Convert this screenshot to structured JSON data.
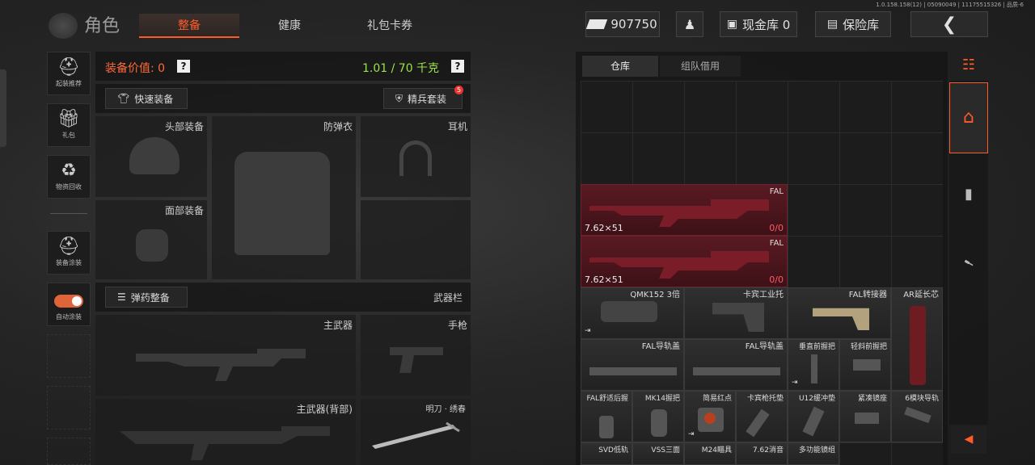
{
  "version": "1.0.158.158(12) | 05090049 | 11175515326 | 品质-6",
  "header": {
    "role_title": "角色",
    "tabs": [
      "整备",
      "健康",
      "礼包卡券"
    ],
    "money": "907750",
    "vault_label": "现金库 0",
    "safe_label": "保险库"
  },
  "sidebar": {
    "items": [
      "起装推荐",
      "礼包",
      "物资回收",
      "装备涂装",
      "自动涂装"
    ]
  },
  "equip": {
    "value_label": "装备价值: 0",
    "weight": "1.01 / 70 千克",
    "quick_equip": "快速装备",
    "elite_set": "精兵套装",
    "elite_badge": "5",
    "slots": {
      "head": "头部装备",
      "armor": "防弹衣",
      "ear": "耳机",
      "face": "面部装备"
    },
    "ammo_btn": "弹药整备",
    "weapon_bar": "武器栏",
    "main_weapon": "主武器",
    "pistol": "手枪",
    "main_back": "主武器(背部)",
    "melee": "明刀 · 绣春"
  },
  "warehouse": {
    "tabs": [
      "仓库",
      "组队借用"
    ],
    "items": [
      {
        "name": "FAL",
        "ammo": "7.62×51",
        "count": "0/0"
      },
      {
        "name": "FAL",
        "ammo": "7.62×51",
        "count": "0/0"
      },
      {
        "name": "QMK152 3倍"
      },
      {
        "name": "卡宾工业托"
      },
      {
        "name": "FAL转接器"
      },
      {
        "name": "AR延长芯"
      },
      {
        "name": "FAL导轨盖"
      },
      {
        "name": "FAL导轨盖"
      },
      {
        "name": "垂直前握把"
      },
      {
        "name": "轻斜前握把"
      },
      {
        "name": "FAL舒适后握"
      },
      {
        "name": "MK14握把"
      },
      {
        "name": "简易红点"
      },
      {
        "name": "卡宾枪托垫"
      },
      {
        "name": "U12缓冲垫"
      },
      {
        "name": "紧凑镜座"
      },
      {
        "name": "6模块导轨"
      },
      {
        "name": "SVD低轨"
      },
      {
        "name": "VSS三面"
      },
      {
        "name": "M24瞄具"
      },
      {
        "name": "7.62消音"
      },
      {
        "name": "多功能镜组"
      }
    ]
  }
}
